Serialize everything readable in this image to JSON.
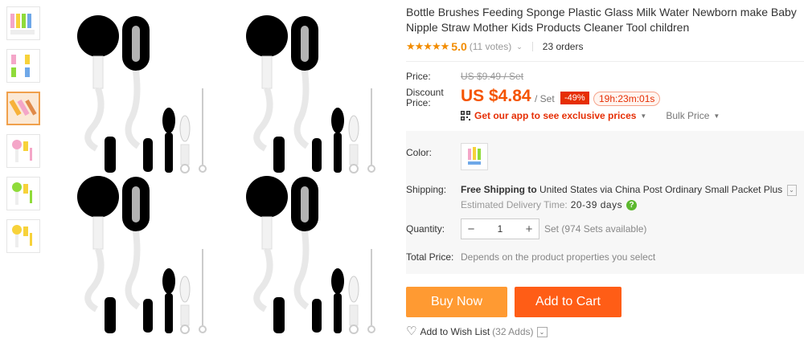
{
  "product": {
    "title": "Bottle Brushes Feeding Sponge Plastic Glass Milk Water Newborn make Baby Nipple Straw Mother Kids Products Cleaner Tool children",
    "stars": "★★★★★",
    "rating": "5.0",
    "votes": "(11 votes)",
    "orders": "23 orders"
  },
  "price": {
    "label": "Price:",
    "original": "US $9.49 / Set",
    "discount_label_1": "Discount",
    "discount_label_2": "Price:",
    "current": "US $4.84",
    "unit": "/ Set",
    "discount_pct": "-49%",
    "timer": "19h:23m:01s",
    "app_promo": "Get our app to see exclusive prices",
    "bulk": "Bulk Price"
  },
  "options": {
    "color_label": "Color:",
    "shipping_label": "Shipping:",
    "shipping_free": "Free Shipping to",
    "shipping_dest": "United States via China Post Ordinary Small Packet Plus",
    "delivery_label": "Estimated Delivery Time:",
    "delivery_days": "20-39 days",
    "help_icon": "?",
    "quantity_label": "Quantity:",
    "qty_minus": "−",
    "qty_value": "1",
    "qty_plus": "+",
    "availability": "Set (974 Sets available)",
    "total_label": "Total Price:",
    "total_note": "Depends on the product properties you select"
  },
  "actions": {
    "buy_now": "Buy Now",
    "add_to_cart": "Add to Cart",
    "wish_heart": "♡",
    "wish_label": "Add to Wish List",
    "wish_count": "(32 Adds)"
  },
  "colors": {
    "accent_price": "#f55400",
    "discount_badge": "#e62e04",
    "buy_now": "#ff9a32",
    "add_to_cart": "#ff5d16",
    "brush_pink": "#f4a6c8",
    "brush_yellow": "#f7d23a",
    "brush_green": "#8fdb3a",
    "brush_blue": "#6fa8e8"
  }
}
